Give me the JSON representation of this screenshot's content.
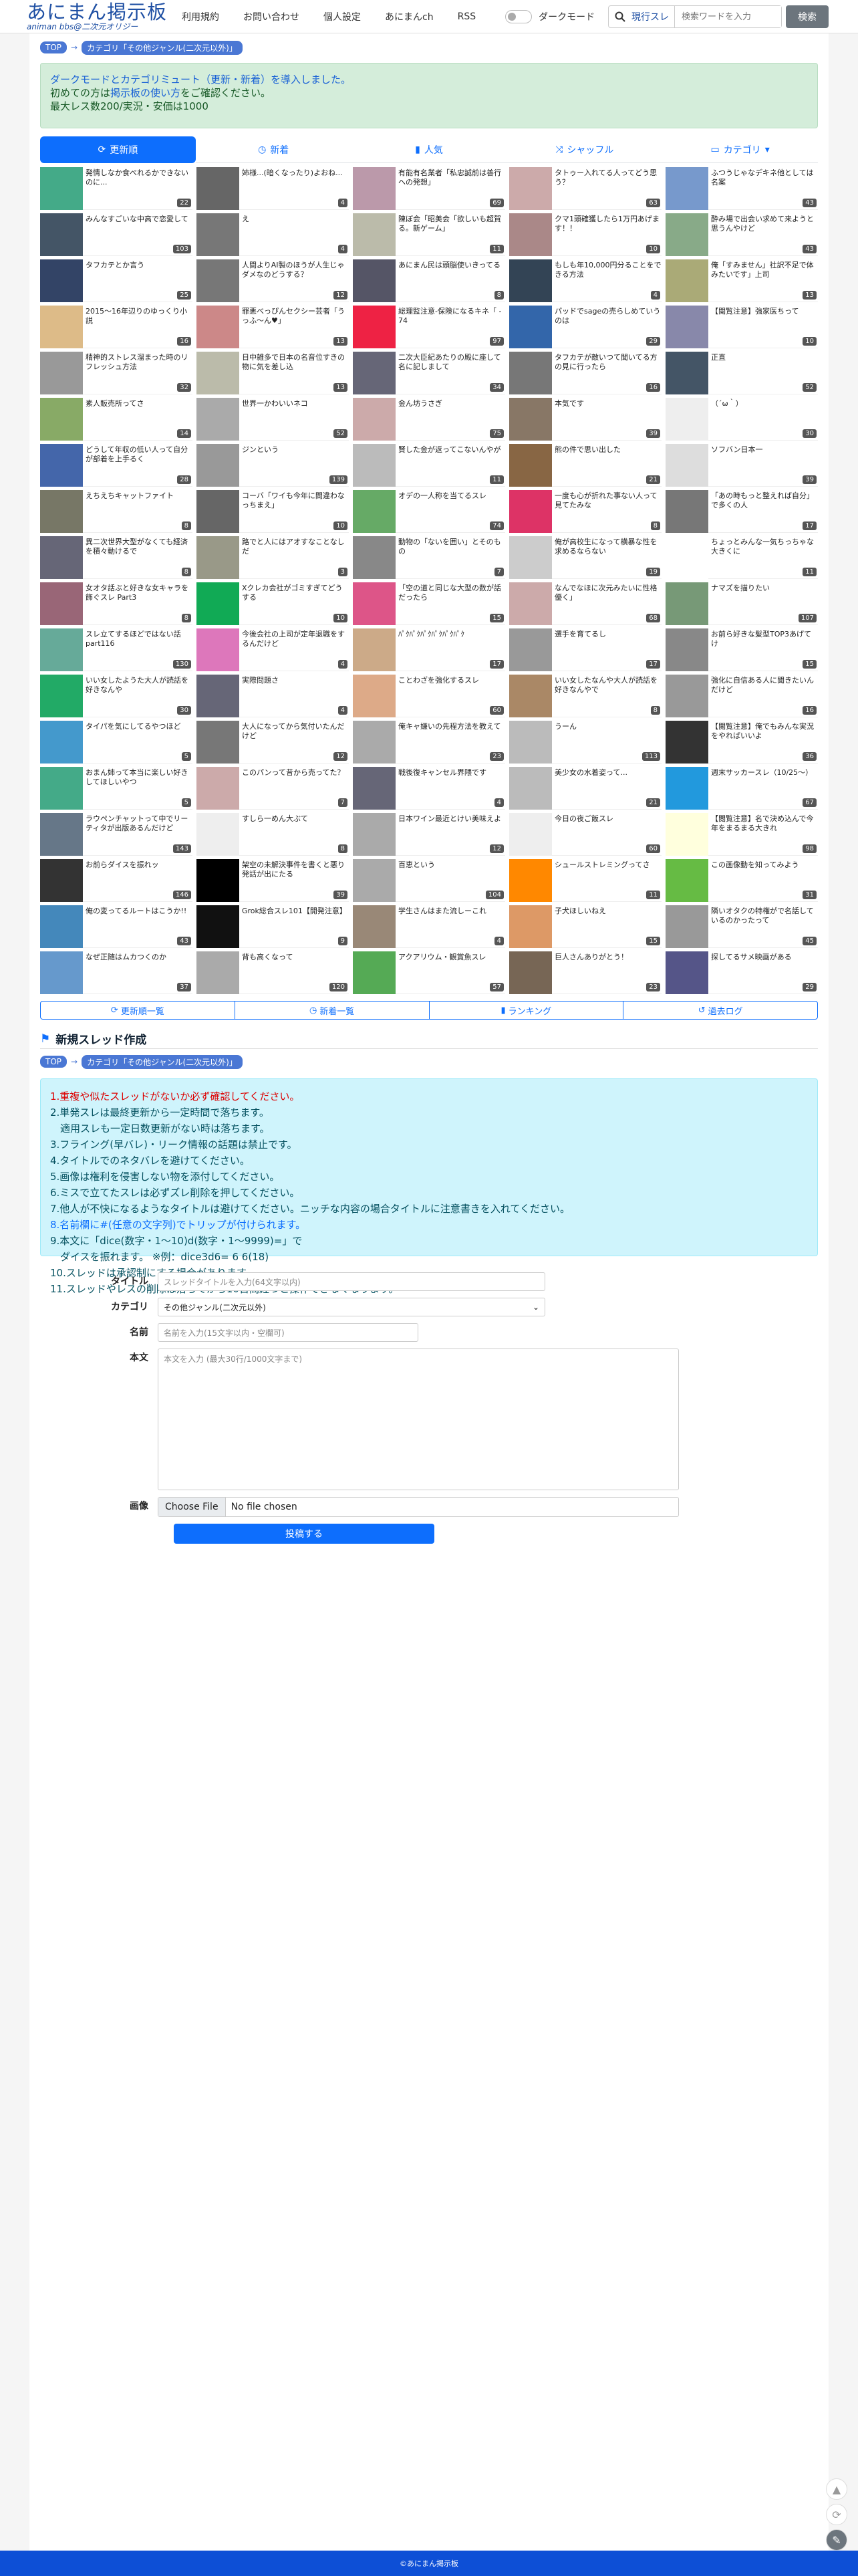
{
  "header": {
    "logo_main": "あにまん掲示板",
    "logo_sub": "animan bbs@二次元オリジー",
    "nav": [
      "利用規約",
      "お問い合わせ",
      "個人設定",
      "あにまんch",
      "RSS"
    ],
    "dark_mode_label": "ダークモード",
    "search_scope": "現行スレ",
    "search_placeholder": "検索ワードを入力",
    "search_button": "検索"
  },
  "breadcrumb": {
    "top": "TOP",
    "category": "カテゴリ「その他ジャンル(二次元以外)」"
  },
  "notice": {
    "line1": "ダークモードとカテゴリミュート（更新・新着）を導入しました。",
    "line2_pre": "初めての方は",
    "line2_link": "掲示板の使い方",
    "line2_post": "をご確認ください。",
    "line3": "最大レス数200/実況・安価は1000"
  },
  "tabs": [
    "更新順",
    "新着",
    "人気",
    "シャッフル",
    "カテゴリ"
  ],
  "threads": [
    {
      "t": "発情しなか食べれるかできないのに...",
      "c": "22",
      "col": "#4a8"
    },
    {
      "t": "姉様...(暗くなったり)よおね...",
      "c": "4",
      "col": "#666"
    },
    {
      "t": "有能有名業者「私忠誠前は善行への発想」",
      "c": "69",
      "col": "#b9a"
    },
    {
      "t": "タトゥー入れてる人ってどう思う？",
      "c": "63",
      "col": "#caa"
    },
    {
      "t": "ふつうじゃなデキネ他としては名案",
      "c": "43",
      "col": "#79c"
    },
    {
      "t": "みんなすごいな中高で恋愛して",
      "c": "103",
      "col": "#456"
    },
    {
      "t": "え",
      "c": "4",
      "col": "#777"
    },
    {
      "t": "陳ぼ会「昭美会「欲しいも超賀る。新ゲーム」",
      "c": "11",
      "col": "#bba"
    },
    {
      "t": "クマ1頭確獲したら1万円あげます！！",
      "c": "10",
      "col": "#a88"
    },
    {
      "t": "酔み場で出会い求めて来ようと思うんやけど",
      "c": "43",
      "col": "#8a8"
    },
    {
      "t": "タフカテとか言う",
      "c": "25",
      "col": "#346"
    },
    {
      "t": "人間よりAI製のほうが人生じゃダメなのどうする？",
      "c": "12",
      "col": "#777"
    },
    {
      "t": "あにまん民は頭脳使いきってる",
      "c": "8",
      "col": "#556"
    },
    {
      "t": "もしも年10,000円分ることをできる方法",
      "c": "4",
      "col": "#345"
    },
    {
      "t": "俺「すみません」社訳不足で体みたいです」上司",
      "c": "13",
      "col": "#aa7"
    },
    {
      "t": "2015〜16年辺りのゆっくり小説",
      "c": "16",
      "col": "#db8"
    },
    {
      "t": "罪悪べっぴんセクシー芸者「うっふ～ん♥」",
      "c": "13",
      "col": "#c88"
    },
    {
      "t": "総理監注意-保険になるキネ「 - 74",
      "c": "97",
      "col": "#e24"
    },
    {
      "t": "パッドでsageの売らしめていうのは",
      "c": "29",
      "col": "#36a"
    },
    {
      "t": "【閲覧注意】強家医ちって",
      "c": "10",
      "col": "#88a"
    },
    {
      "t": "精神的ストレス溜まった時のリフレッシュ方法",
      "c": "32",
      "col": "#999"
    },
    {
      "t": "日中雑多で日本の名音位すきの物に気を差し込",
      "c": "13",
      "col": "#bba"
    },
    {
      "t": "二次大臣紀あたりの殿に座して名に記しまして",
      "c": "34",
      "col": "#667"
    },
    {
      "t": "タフカテが敵いつて聞いてる方の見に行ったら",
      "c": "16",
      "col": "#777"
    },
    {
      "t": "正直",
      "c": "52",
      "col": "#456"
    },
    {
      "t": "素人販売所ってさ",
      "c": "14",
      "col": "#8a6"
    },
    {
      "t": "世界一かわいいネコ",
      "c": "52",
      "col": "#aaa"
    },
    {
      "t": "金ん坊うさぎ",
      "c": "75",
      "col": "#caa"
    },
    {
      "t": "本気です",
      "c": "39",
      "col": "#876"
    },
    {
      "t": "（´ω｀）",
      "c": "30",
      "col": "#eee"
    },
    {
      "t": "どうして年収の低い人って自分が部着を上手るく",
      "c": "28",
      "col": "#46a"
    },
    {
      "t": "ジンという",
      "c": "139",
      "col": "#999"
    },
    {
      "t": "賢した金が返ってこないんやが",
      "c": "11",
      "col": "#bbb"
    },
    {
      "t": "熊の件で思い出した",
      "c": "21",
      "col": "#864"
    },
    {
      "t": "ソフバン日本一",
      "c": "39",
      "col": "#ddd"
    },
    {
      "t": "えちえちキャットファイト",
      "c": "8",
      "col": "#776"
    },
    {
      "t": "コーバ「ワイも今年に間違わなっちまえ」",
      "c": "10",
      "col": "#666"
    },
    {
      "t": "オデの一人称を当てるスレ",
      "c": "74",
      "col": "#6a6"
    },
    {
      "t": "一度も心が折れた事ない人って見てたみな",
      "c": "8",
      "col": "#d36"
    },
    {
      "t": "「あの時もっと整えれば自分」で多くの人",
      "c": "17",
      "col": "#777"
    },
    {
      "t": "異二次世界大型がなくても経済を積々動けるで",
      "c": "8",
      "col": "#667"
    },
    {
      "t": "路でと人にはアオすなことなしだ",
      "c": "3",
      "col": "#998"
    },
    {
      "t": "動物の「ないを囲い」とそのもの",
      "c": "7",
      "col": "#888"
    },
    {
      "t": "俺が高校生になって横暴な性を求めるならない",
      "c": "19",
      "col": "#ccc"
    },
    {
      "t": "ちょっとみんな一気ちっちゃな大きくに",
      "c": "11",
      "col": "#fff"
    },
    {
      "t": "女オタ話ぶと好きな女キャラを飾ぐスレ Part3",
      "c": "8",
      "col": "#967"
    },
    {
      "t": "Xクレカ会社がゴミすぎてどうする",
      "c": "10",
      "col": "#1a5"
    },
    {
      "t": "「空の道と同じな大型の数が話だったら",
      "c": "15",
      "col": "#d58"
    },
    {
      "t": "なんでなほに次元みたいに性格優く」",
      "c": "68",
      "col": "#caa"
    },
    {
      "t": "ナマズを描りたい",
      "c": "107",
      "col": "#797"
    },
    {
      "t": "スレ立てするほどではない話part116",
      "c": "130",
      "col": "#6a9"
    },
    {
      "t": "今後会社の上司が定年退職をするんだけど",
      "c": "4",
      "col": "#d7b"
    },
    {
      "t": "ﾊﾟｸﾊﾟｸﾊﾟｸﾊﾟｸﾊﾟｸﾊﾟｸ",
      "c": "17",
      "col": "#ca8"
    },
    {
      "t": "選手を育てるし",
      "c": "17",
      "col": "#999"
    },
    {
      "t": "お前ら好きな髪型TOP3あげてけ",
      "c": "15",
      "col": "#888"
    },
    {
      "t": "いい女したようた大人が読話を好きなんや",
      "c": "30",
      "col": "#2a6"
    },
    {
      "t": "実際問題さ",
      "c": "4",
      "col": "#667"
    },
    {
      "t": "ことわざを強化するスレ",
      "c": "60",
      "col": "#da8"
    },
    {
      "t": "いい女したなんや大人が読話を好きなんやで",
      "c": "8",
      "col": "#a86"
    },
    {
      "t": "強化に自信ある人に聞きたいんだけど",
      "c": "16",
      "col": "#999"
    },
    {
      "t": "タイパを気にしてるやつほど",
      "c": "5",
      "col": "#49c"
    },
    {
      "t": "大人になってから気付いたんだけど",
      "c": "12",
      "col": "#777"
    },
    {
      "t": "俺キャ嫌いの先程方法を教えて",
      "c": "23",
      "col": "#aaa"
    },
    {
      "t": "うーん",
      "c": "113",
      "col": "#bbb"
    },
    {
      "t": "【閲覧注意】俺でもみんな実況をやればいいよ",
      "c": "36",
      "col": "#333"
    },
    {
      "t": "おまん姉って本当に楽しい好きしてほしいやつ",
      "c": "5",
      "col": "#4a8"
    },
    {
      "t": "このパンって昔から売ってた？",
      "c": "7",
      "col": "#caa"
    },
    {
      "t": "戦後復キャンセル界隈です",
      "c": "4",
      "col": "#667"
    },
    {
      "t": "美少女の水着姿って...",
      "c": "21",
      "col": "#bbb"
    },
    {
      "t": "週末サッカースレ（10/25〜）",
      "c": "67",
      "col": "#29d"
    },
    {
      "t": "ラウペンチャットって中でリーティタが出版あるんだけど",
      "c": "143",
      "col": "#678"
    },
    {
      "t": "すしら一めん大ぶて",
      "c": "8",
      "col": "#eee"
    },
    {
      "t": "日本ワイン最近とけい美味えよ",
      "c": "12",
      "col": "#aaa"
    },
    {
      "t": "今日の夜ご飯スレ",
      "c": "60",
      "col": "#eee"
    },
    {
      "t": "【閲覧注意】名で決め込んで今年をまるまる大きれ",
      "c": "98",
      "col": "#ffd"
    },
    {
      "t": "お前らダイスを振れッ",
      "c": "146",
      "col": "#333"
    },
    {
      "t": "架空の未解決事件を書くと悪り発話が出にたる",
      "c": "39",
      "col": "#000"
    },
    {
      "t": "百恵という",
      "c": "104",
      "col": "#aaa"
    },
    {
      "t": "シュールストレミングってさ",
      "c": "11",
      "col": "#f80"
    },
    {
      "t": "この画像動を知ってみよう",
      "c": "31",
      "col": "#6b4"
    },
    {
      "t": "俺の変ってるルートはこうか!!",
      "c": "43",
      "col": "#48b"
    },
    {
      "t": "Grok総合スレ101【開発注意】",
      "c": "9",
      "col": "#111"
    },
    {
      "t": "学生さんはまた流しーこれ",
      "c": "4",
      "col": "#987"
    },
    {
      "t": "子犬ほしいねえ",
      "c": "15",
      "col": "#d96"
    },
    {
      "t": "隣いオタクの特権がで名話しているのかったって",
      "c": "45",
      "col": "#999"
    },
    {
      "t": "なぜ正随はムカつくのか",
      "c": "37",
      "col": "#69c"
    },
    {
      "t": "背も高くなって",
      "c": "120",
      "col": "#aaa"
    },
    {
      "t": "アクアリウム・観賞魚スレ",
      "c": "57",
      "col": "#5a5"
    },
    {
      "t": "巨人さんありがとう！",
      "c": "23",
      "col": "#765"
    },
    {
      "t": "探してるサメ映画がある",
      "c": "29",
      "col": "#558"
    }
  ],
  "bottom_nav": [
    "更新順一覧",
    "新着一覧",
    "ランキング",
    "過去ログ"
  ],
  "new_thread": {
    "heading": "新規スレッド作成",
    "rules": [
      "1.重複や似たスレッドがないか必ず確認してください。",
      "2.単発スレは最終更新から一定時間で落ちます。",
      "　適用スレも一定日数更新がない時は落ちます。",
      "3.フライング(早バレ)・リーク情報の話題は禁止です。",
      "4.タイトルでのネタバレを避けてください。",
      "5.画像は権利を侵害しない物を添付してください。",
      "6.ミスで立てたスレは必ずズレ削除を押してください。",
      "7.他人が不快になるようなタイトルは避けてください。ニッチな内容の場合タイトルに注意書きを入れてください。",
      "8.名前欄に#(任意の文字列)でトリップが付けられます。",
      "9.本文に「dice(数字・1〜10)d(数字・1〜9999)=」で",
      "　ダイスを振れます。 ※例：dice3d6= 6 6(18)",
      "10.スレッドは承認制にする場合があります。",
      "11.スレッドやレスの削除は落ちてから10日間経つと操作できなくなります。"
    ],
    "labels": {
      "title": "タイトル",
      "category": "カテゴリ",
      "name": "名前",
      "body": "本文",
      "image": "画像"
    },
    "placeholders": {
      "title": "スレッドタイトルを入力(64文字以内)",
      "name": "名前を入力(15文字以内・空欄可)",
      "body": "本文を入力 (最大30行/1000文字まで)"
    },
    "category_value": "その他ジャンル(二次元以外)",
    "file_button": "Choose File",
    "file_status": "No file chosen",
    "submit": "投稿する"
  },
  "footer": "©あにまん掲示板"
}
